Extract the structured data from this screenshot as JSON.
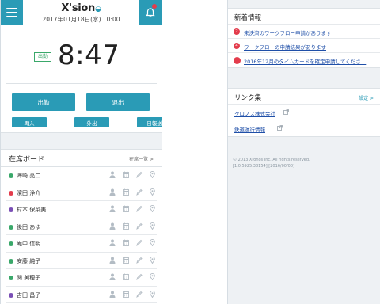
{
  "header": {
    "logo": "X'sion",
    "date": "2017年01月18日(水) 10:00"
  },
  "clock": {
    "status": "出勤",
    "time": "8:47"
  },
  "buttons": {
    "clock_in": "出勤",
    "clock_out": "退出",
    "re_entry": "再入",
    "go_out": "外出",
    "day_report": "日報送"
  },
  "board": {
    "title": "在席ボード",
    "link": "在席一覧 >",
    "people": [
      {
        "name": "海崎 亮二",
        "status_color": "#3aa86a"
      },
      {
        "name": "濱田 浄介",
        "status_color": "#e33c4c"
      },
      {
        "name": "村本 保菜美",
        "status_color": "#7a4fb5"
      },
      {
        "name": "後田 あゆ",
        "status_color": "#3aa86a"
      },
      {
        "name": "庵中 信明",
        "status_color": "#3aa86a"
      },
      {
        "name": "安藤 純子",
        "status_color": "#3aa86a"
      },
      {
        "name": "関 美穂子",
        "status_color": "#3aa86a"
      },
      {
        "name": "吉田 昌子",
        "status_color": "#7a4fb5"
      }
    ]
  },
  "news": {
    "title": "新着情報",
    "items": [
      {
        "num": "2",
        "text": "未決済のワークフロー申請があります"
      },
      {
        "num": "4",
        "text": "ワークフローの申請結果があります"
      },
      {
        "num": "",
        "text": "2016年12月のタイムカードを確定申請してくださ…"
      }
    ]
  },
  "links": {
    "title": "リンク集",
    "settings": "設定 >",
    "items": [
      {
        "text": "クロノス株式会社"
      },
      {
        "text": "鉄道運行情報"
      }
    ]
  },
  "footer": {
    "copyright": "© 2013 Xronos Inc. All rights reserved.",
    "version": "[1.0.5925.38154] [2016/00/00]"
  },
  "colors": {
    "accent": "#2a9bb6",
    "alert": "#e33c4c",
    "present": "#3aa86a",
    "away": "#7a4fb5"
  }
}
